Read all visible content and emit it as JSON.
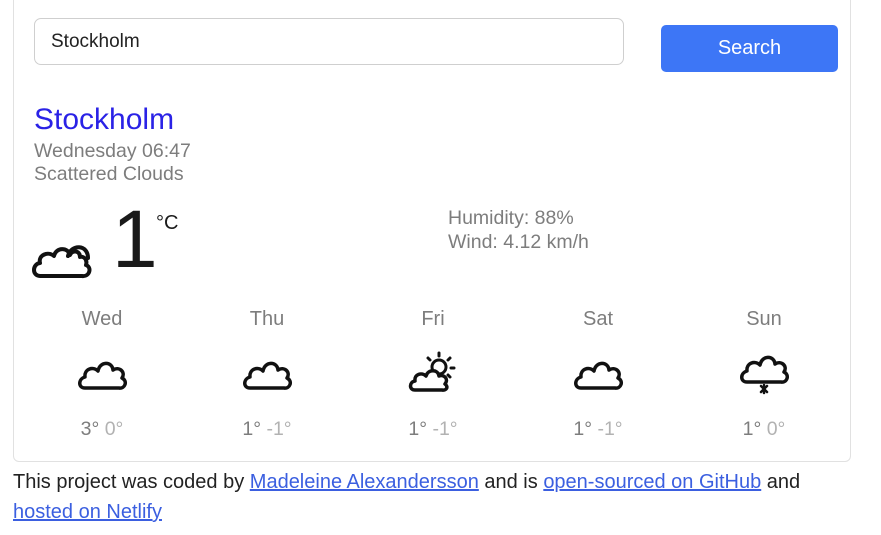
{
  "search": {
    "value": "Stockholm",
    "button_label": "Search"
  },
  "current": {
    "city": "Stockholm",
    "datetime": "Wednesday 06:47",
    "description": "Scattered Clouds",
    "temperature": "1",
    "unit": "°C",
    "icon": "cloud-icon",
    "humidity": "Humidity: 88%",
    "wind": "Wind: 4.12 km/h"
  },
  "forecast": [
    {
      "day": "Wed",
      "high": "3°",
      "low": "0°",
      "icon": "cloud-icon"
    },
    {
      "day": "Thu",
      "high": "1°",
      "low": "-1°",
      "icon": "cloud-icon"
    },
    {
      "day": "Fri",
      "high": "1°",
      "low": "-1°",
      "icon": "sun-behind-cloud-icon"
    },
    {
      "day": "Sat",
      "high": "1°",
      "low": "-1°",
      "icon": "cloud-icon"
    },
    {
      "day": "Sun",
      "high": "1°",
      "low": "0°",
      "icon": "cloud-snow-icon"
    }
  ],
  "footer": {
    "text_1": "This project was coded by ",
    "author_link": "Madeleine Alexandersson",
    "text_2": " and is ",
    "github_link": "open-sourced on GitHub",
    "text_3": " and",
    "netlify_link": "hosted on Netlify"
  },
  "colors": {
    "accent": "#3d76f6",
    "city": "#2a22e6",
    "link": "#3b5fe0",
    "muted": "#7d7d7d"
  }
}
